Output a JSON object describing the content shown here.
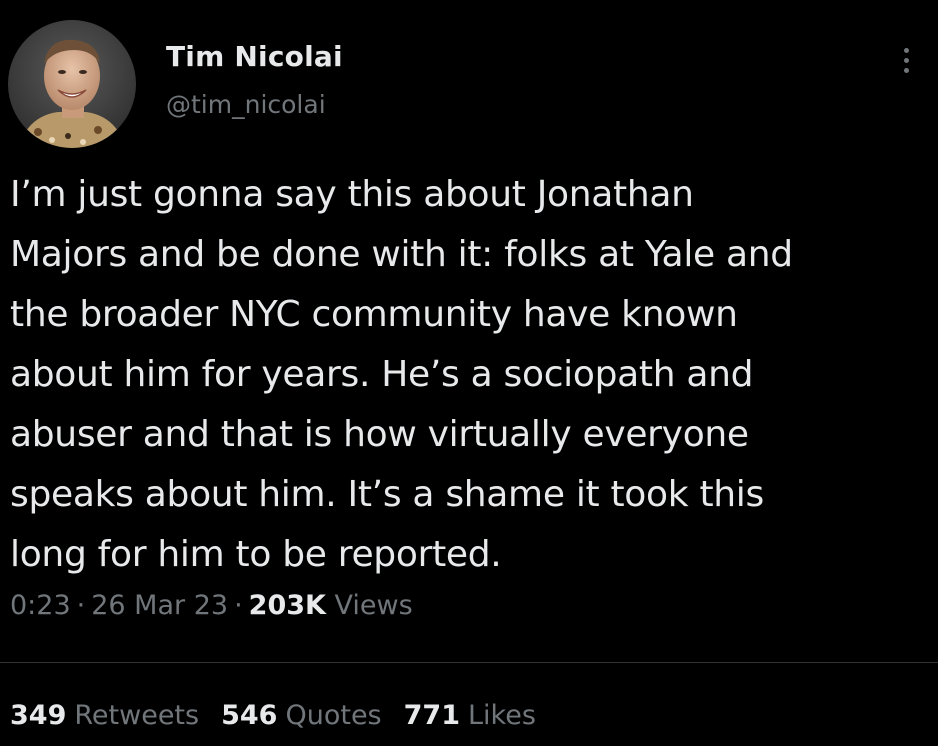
{
  "user": {
    "name": "Tim Nicolai",
    "handle": "@tim_nicolai"
  },
  "tweet": {
    "text": "I’m just gonna say this about Jonathan\nMajors and be done with it: folks at Yale and\nthe broader NYC community have known\nabout him for years. He’s a sociopath and\nabuser and that is how virtually everyone\nspeaks about him. It’s a shame it took this\nlong for him to be reported.",
    "time": "0:23",
    "separator": "·",
    "date": "26 Mar 23",
    "views_count": "203K",
    "views_label": "Views"
  },
  "stats": {
    "retweets_count": "349",
    "retweets_label": "Retweets",
    "quotes_count": "546",
    "quotes_label": "Quotes",
    "likes_count": "771",
    "likes_label": "Likes"
  },
  "icons": {
    "more": "more-options-icon"
  },
  "colors": {
    "background": "#000000",
    "primary_text": "#e7e9ea",
    "secondary_text": "#71767b",
    "divider": "#2f3336"
  }
}
